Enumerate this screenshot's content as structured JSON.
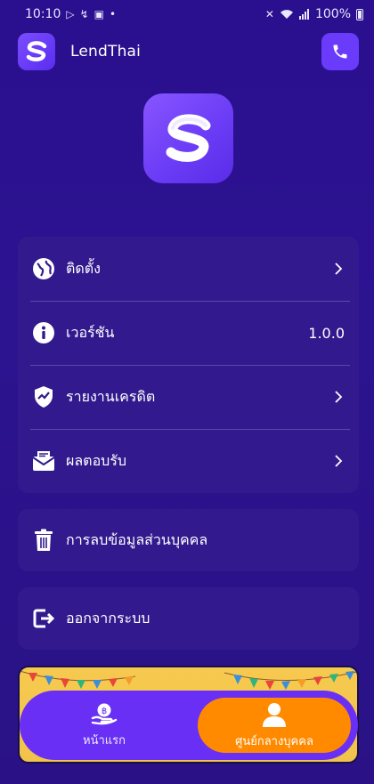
{
  "status_bar": {
    "time": "10:10",
    "battery": "100%",
    "icons": [
      "play-icon",
      "missed-call-icon",
      "clipboard-icon",
      "dot-icon",
      "mute-icon",
      "wifi-icon",
      "signal-icon",
      "battery-icon"
    ]
  },
  "header": {
    "title": "LendThai",
    "logo_icon": "app-logo-icon",
    "phone_icon": "phone-icon"
  },
  "menu": {
    "items": [
      {
        "label": "ติดตั้ง",
        "icon": "globe-icon",
        "right": ""
      },
      {
        "label": "เวอร์ชัน",
        "icon": "info-icon",
        "right": "1.0.0"
      },
      {
        "label": "รายงานเครดิต",
        "icon": "shield-chart-icon",
        "right": ""
      },
      {
        "label": "ผลตอบรับ",
        "icon": "mail-icon",
        "right": ""
      }
    ]
  },
  "delete_account": {
    "label": "การลบข้อมูลส่วนบุคคล",
    "icon": "trash-icon"
  },
  "logout": {
    "label": "ออกจากระบบ",
    "icon": "logout-icon"
  },
  "bottom_nav": {
    "home_label": "หน้าแรก",
    "profile_label": "ศูนย์กลางบุคคล",
    "active": "profile"
  },
  "colors": {
    "background": "#2a0f8e",
    "card": "#321a8e",
    "accent": "#6a3bfa",
    "active_tab": "#ff8a00",
    "banner": "#f6c94f"
  }
}
